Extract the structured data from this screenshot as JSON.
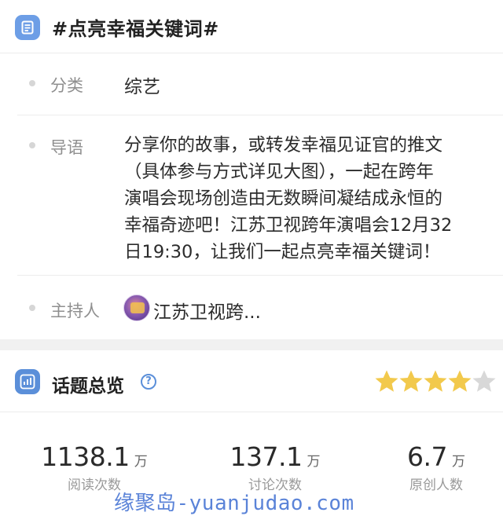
{
  "topic": {
    "title": "#点亮幸福关键词#"
  },
  "info": {
    "category_label": "分类",
    "category_value": "综艺",
    "guide_label": "导语",
    "guide_value": "分享你的故事，或转发幸福见证官的推文\n（具体参与方式详见大图），一起在跨年\n演唱会现场创造由无数瞬间凝结成永恒的\n幸福奇迹吧！江苏卫视跨年演唱会12月32\n日19:30，让我们一起点亮幸福关键词！",
    "host_label": "主持人",
    "host_value": "江苏卫视跨..."
  },
  "overview": {
    "title": "话题总览",
    "help_glyph": "?",
    "rating_stars": 4,
    "rating_max": 5,
    "star_color_on": "#f2c94c",
    "star_color_off": "#d8d8d8",
    "stats": [
      {
        "value": "1138.1",
        "unit": "万",
        "label": "阅读次数"
      },
      {
        "value": "137.1",
        "unit": "万",
        "label": "讨论次数"
      },
      {
        "value": "6.7",
        "unit": "万",
        "label": "原创人数"
      }
    ]
  },
  "watermark": "缘聚岛-yuanjudao.com",
  "icons": {
    "title_icon": "document-icon",
    "overview_icon": "chart-icon",
    "help_icon": "help-icon"
  },
  "colors": {
    "accent": "#5b8fd9",
    "title_icon_bg": "#6d9ee6"
  }
}
